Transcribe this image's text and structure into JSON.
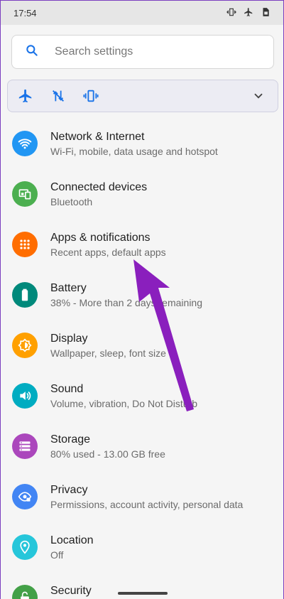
{
  "status": {
    "time": "17:54",
    "icons": [
      "vibrate-icon",
      "airplane-icon",
      "sim-icon"
    ]
  },
  "search": {
    "placeholder": "Search settings"
  },
  "quick_settings": {
    "icons": [
      "airplane-icon",
      "no-data-icon",
      "vibrate-icon"
    ],
    "expand": "chevron-down-icon"
  },
  "colors": {
    "accent": "#1a73e8",
    "network": "#2196f3",
    "connected": "#4caf50",
    "apps": "#ff6d00",
    "battery": "#00897b",
    "display": "#ffa000",
    "sound": "#00acc1",
    "storage": "#ab47bc",
    "privacy": "#4285f4",
    "location": "#26c6da",
    "security": "#43a047",
    "annotation_arrow": "#8a1fbd"
  },
  "settings": [
    {
      "title": "Network & Internet",
      "sub": "Wi-Fi, mobile, data usage and hotspot",
      "icon": "wifi-icon"
    },
    {
      "title": "Connected devices",
      "sub": "Bluetooth",
      "icon": "devices-icon"
    },
    {
      "title": "Apps & notifications",
      "sub": "Recent apps, default apps",
      "icon": "apps-grid-icon"
    },
    {
      "title": "Battery",
      "sub": "38% - More than 2 days remaining",
      "icon": "battery-icon"
    },
    {
      "title": "Display",
      "sub": "Wallpaper, sleep, font size",
      "icon": "brightness-icon"
    },
    {
      "title": "Sound",
      "sub": "Volume, vibration, Do Not Disturb",
      "icon": "volume-icon"
    },
    {
      "title": "Storage",
      "sub": "80% used - 13.00 GB free",
      "icon": "storage-icon"
    },
    {
      "title": "Privacy",
      "sub": "Permissions, account activity, personal data",
      "icon": "eye-icon"
    },
    {
      "title": "Location",
      "sub": "Off",
      "icon": "location-pin-icon"
    },
    {
      "title": "Security",
      "sub": "",
      "icon": "lock-icon"
    }
  ]
}
